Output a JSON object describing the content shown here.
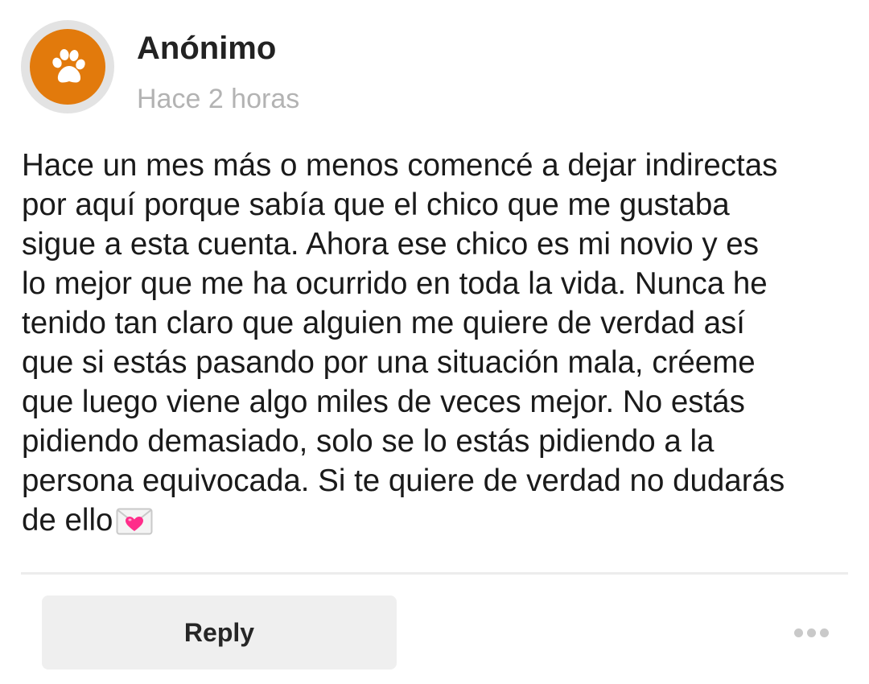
{
  "post": {
    "author": "Anónimo",
    "timestamp": "Hace 2 horas",
    "avatar_icon": "paw-icon",
    "avatar_color": "#e27a0c",
    "message": "Hace un mes más o menos comencé a dejar indirectas\npor aquí porque sabía que el chico que me gustaba\nsigue a esta cuenta. Ahora ese chico es mi novio y es\nlo mejor que me ha ocurrido en toda la vida. Nunca he\ntenido tan claro que alguien me quiere de verdad así\nque si estás pasando por una situación mala, créeme\nque luego viene algo miles de veces mejor. No estás\npidiendo demasiado, solo se lo estás pidiendo a la\npersona equivocada. Si te quiere de verdad no dudarás\nde ello",
    "message_emoji": "love-letter-icon"
  },
  "actions": {
    "reply_label": "Reply",
    "more_icon": "more-horizontal-icon"
  }
}
